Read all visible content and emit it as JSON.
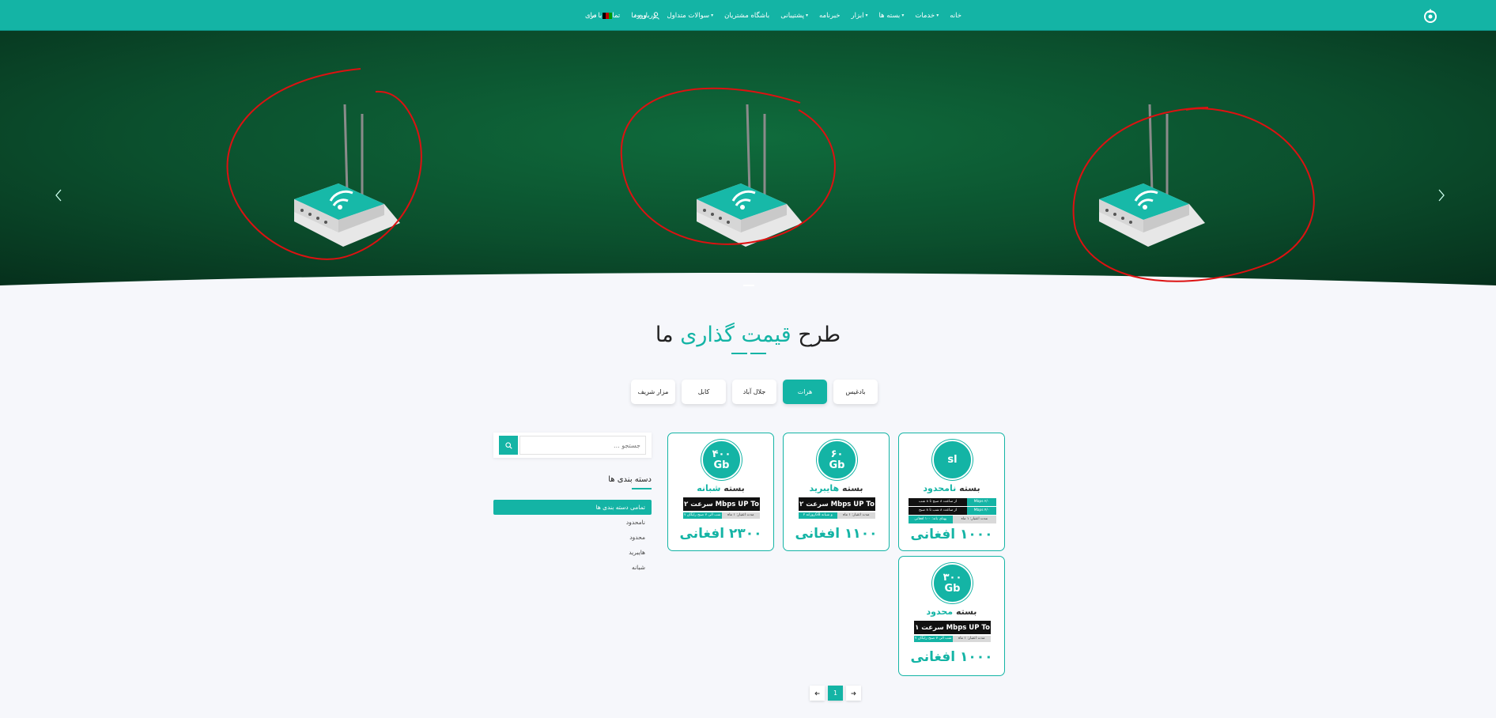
{
  "header": {
    "nav": [
      {
        "label": "خانه",
        "dropdown": false
      },
      {
        "label": "خدمات",
        "dropdown": true
      },
      {
        "label": "بسته ها",
        "dropdown": true
      },
      {
        "label": "ابزار",
        "dropdown": true
      },
      {
        "label": "خبرنامه",
        "dropdown": false
      },
      {
        "label": "پشتیبانی",
        "dropdown": true
      },
      {
        "label": "باشگاه مشتریان",
        "dropdown": false
      },
      {
        "label": "سوالات متداول",
        "dropdown": true
      },
      {
        "label": "درباره ما",
        "dropdown": false
      },
      {
        "label": "تماس با ما",
        "dropdown": false
      }
    ],
    "login_label": "ورود",
    "language_label": "دری",
    "brand_color": "#14b4a5"
  },
  "pricing": {
    "title_part1": "طرح",
    "title_accent": "قیمت گذاری",
    "title_part2": "ما",
    "tabs": [
      "بادغیس",
      "هرات",
      "جلال آباد",
      "کابل",
      "مزار شریف"
    ],
    "active_tab": "هرات",
    "cards": [
      {
        "badge_top": "sl",
        "badge_bottom": "",
        "name_word": "بسته",
        "name_accent": "نامحدود",
        "rows": [
          [
            "از ساعت ۸ صبح تا ۸ شب",
            "Mbps ۲/۰"
          ],
          [
            "از ساعت ۸ شب تا ۸ صبح",
            "Mbps ۴/۰"
          ],
          [
            "پهنای باند: ۱۰۰ افغانی",
            "مدت اعتبار: ۱ ماه"
          ]
        ],
        "price": "۱۰۰۰ افغانی"
      },
      {
        "badge_top": "۶۰",
        "badge_bottom": "Gb",
        "name_word": "بسته",
        "name_accent": "هایبرید",
        "speed": "سرعت ۲ Mbps UP To",
        "sub_green": "روزانه ۲GB و شبانه ۵۸GB",
        "sub_grey": "مدت اعتبار: ۱ ماه",
        "price": "۱۱۰۰ افغانی"
      },
      {
        "badge_top": "۴۰۰",
        "badge_bottom": "Gb",
        "name_word": "بسته",
        "name_accent": "شبانه",
        "speed": "سرعت ۲ Mbps UP To",
        "sub_green": "۷ شب الی ۷ صبح رایگان",
        "sub_grey": "مدت اعتبار: ۱ ماه",
        "price": "۲۳۰۰ افغانی"
      },
      {
        "badge_top": "۳۰۰",
        "badge_bottom": "Gb",
        "name_word": "بسته",
        "name_accent": "محدود",
        "speed": "سرعت ۱ Mbps UP To",
        "sub_green": "۷ شب الی ۷ صبح رایگان",
        "sub_grey": "مدت اعتبار: ۱ ماه",
        "price": "۱۰۰۰ افغانی"
      }
    ]
  },
  "sidebar": {
    "search_placeholder": "جستجو ...",
    "categories_title": "دسته بندی ها",
    "categories": [
      "تمامی دسته بندی ها",
      "نامحدود",
      "محدود",
      "هایبرید",
      "شبانه"
    ],
    "active_category": "تمامی دسته بندی ها"
  },
  "pagination": {
    "current": "1"
  }
}
